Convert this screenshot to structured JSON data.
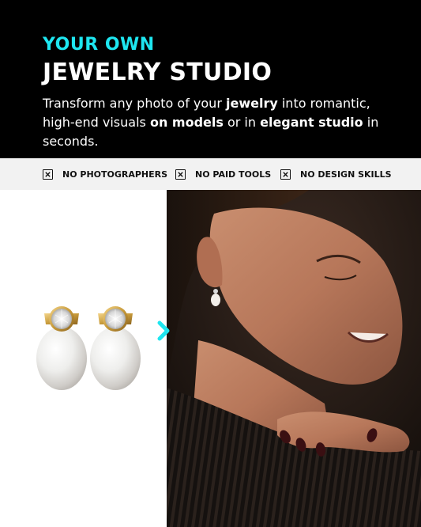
{
  "header": {
    "eyebrow": "YOUR OWN",
    "title": "JEWELRY STUDIO",
    "subtitle": {
      "t1": "Transform any photo of your ",
      "b1": "jewelry",
      "t2": " into romantic, high-end visuals ",
      "b2": "on models",
      "t3": " or in ",
      "b3": "elegant studio",
      "t4": " in seconds."
    },
    "accent_color": "#1ee6f0",
    "background_color": "#000000"
  },
  "features": [
    {
      "icon": "x-box-icon",
      "label": "NO PHOTOGRAPHERS"
    },
    {
      "icon": "x-box-icon",
      "label": "NO PAID TOOLS"
    },
    {
      "icon": "x-box-icon",
      "label": "NO DESIGN SKILLS"
    }
  ],
  "visuals": {
    "arrow_icon": "arrow-right-icon",
    "arrow_color": "#1ee6f0"
  }
}
